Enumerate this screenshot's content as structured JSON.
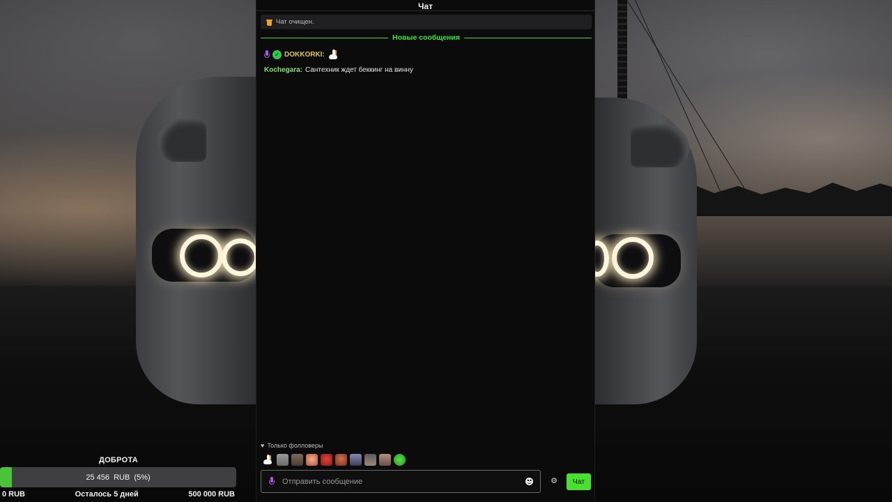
{
  "chat": {
    "title": "Чат",
    "notice": "Чат очищен.",
    "divider_label": "Новые сообщения",
    "messages": [
      {
        "username": "DOKKORKI:",
        "text": "",
        "badges": [
          "mic-icon",
          "verified-icon"
        ],
        "emote": "goose-emote",
        "username_color": "#e0c84a"
      },
      {
        "username": "Kochegara:",
        "text": "Сантехник ждет беккинг на винну",
        "username_color": "#8be36a"
      }
    ],
    "followers_only": "Только фолловеры",
    "input_placeholder": "Отправить сообщение",
    "send_button": "Чат",
    "recent_emotes": [
      "goose",
      "cat",
      "bear",
      "face",
      "demon",
      "man",
      "guy",
      "dance",
      "cat2",
      "green-frog"
    ],
    "accent": "#49e02e"
  },
  "goal": {
    "title": "ДОБРОТА",
    "progress_text": "25 456  RUB  (5%)",
    "progress_fraction": 0.05,
    "min": "0 RUB",
    "remaining": "Осталось 5 дней",
    "max": "500 000 RUB",
    "bar_color": "#4cc23c"
  }
}
